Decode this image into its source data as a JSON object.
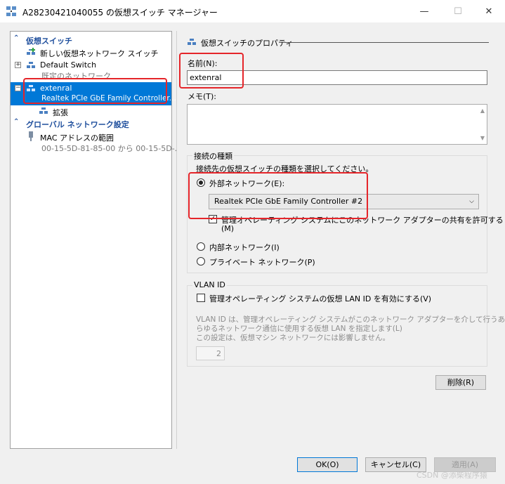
{
  "window": {
    "title": "A28230421040055 の仮想スイッチ マネージャー",
    "minimize": "—",
    "maximize": "☐",
    "close": "✕"
  },
  "tree": {
    "virtual_switches_header": "仮想スイッチ",
    "new_switch": "新しい仮想ネットワーク スイッチ",
    "default_switch": "Default Switch",
    "default_switch_sub": "既定のネットワーク",
    "external": "extenral",
    "external_sub": "Realtek PCIe GbE Family Controller...",
    "extensions": "拡張",
    "global_header": "グローバル ネットワーク設定",
    "mac_range": "MAC アドレスの範囲",
    "mac_range_sub": "00-15-5D-81-85-00 から 00-15-5D-..."
  },
  "props": {
    "header": "仮想スイッチのプロパティ",
    "name_label": "名前(N):",
    "name_value": "extenral",
    "memo_label": "メモ(T):",
    "conn_group": "接続の種類",
    "conn_desc": "接続先の仮想スイッチの種類を選択してください。",
    "external_label": "外部ネットワーク(E):",
    "adapter_value": "Realtek PCIe GbE Family Controller #2",
    "allow_mgmt_line1": "管理オペレーティング システムにこのネットワーク アダプターの共有を許可する",
    "allow_mgmt_line2": "(M)",
    "internal_label": "内部ネットワーク(I)",
    "private_label": "プライベート ネットワーク(P)",
    "vlan_group": "VLAN ID",
    "vlan_enable": "管理オペレーティング システムの仮想 LAN ID を有効にする(V)",
    "vlan_desc_1": "VLAN ID は、管理オペレーティング システムがこのネットワーク アダプターを介して行うあ",
    "vlan_desc_2": "らゆるネットワーク通信に使用する仮想 LAN を指定します(L)",
    "vlan_desc_3": "この設定は、仮想マシン ネットワークには影響しません。",
    "vlan_value": "2",
    "delete_button": "削除(R)"
  },
  "footer": {
    "ok": "OK(O)",
    "cancel": "キャンセル(C)",
    "apply": "適用(A)"
  },
  "watermark": "CSDN @添柴程序猿",
  "colors": {
    "selection": "#0078d7",
    "section_header": "#1e4e9c",
    "annotation_box": "#e5252a"
  }
}
